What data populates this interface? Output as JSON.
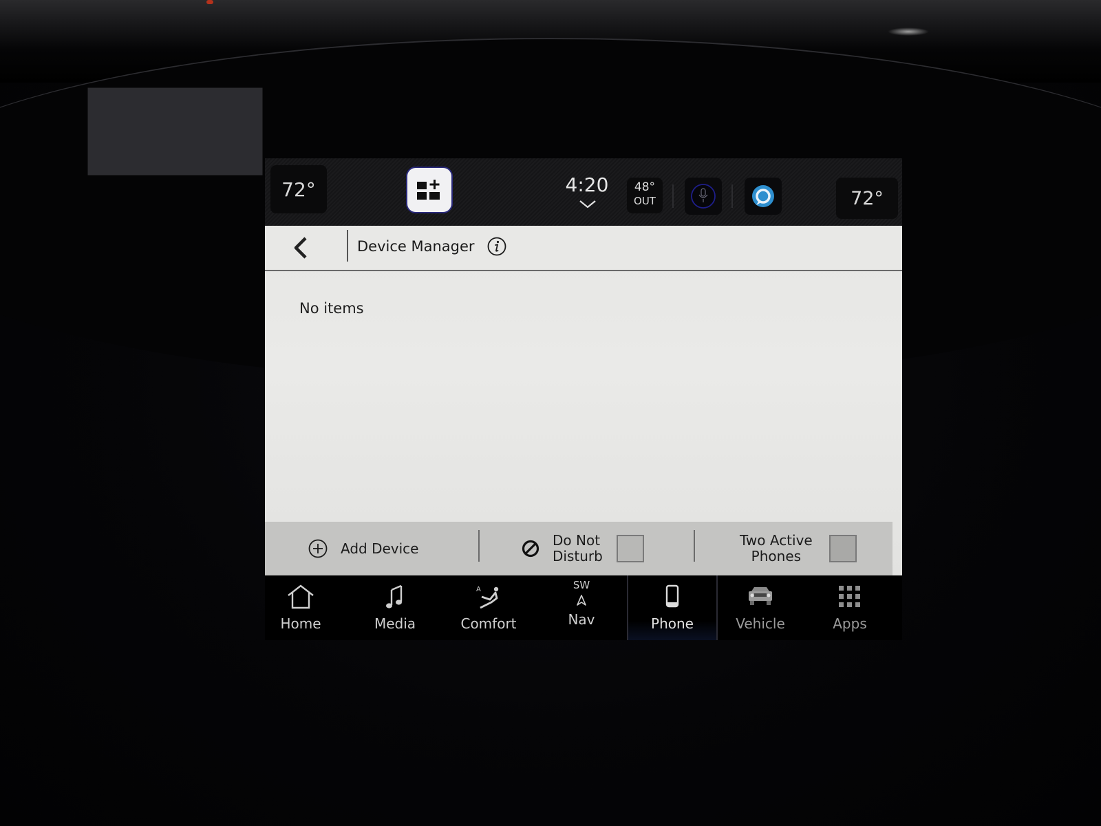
{
  "statusbar": {
    "driver_temp": "72°",
    "passenger_temp": "72°",
    "clock": "4:20",
    "outside_temp": "48°",
    "outside_label": "OUT",
    "widget_button_icon": "widgets-add-icon",
    "voice_icon": "voice-assistant-icon",
    "alexa_icon": "alexa-icon"
  },
  "header": {
    "back_icon": "chevron-left-icon",
    "title": "Device Manager",
    "info_icon": "info-icon"
  },
  "content": {
    "empty_message": "No items"
  },
  "actions": {
    "add_device": {
      "label": "Add Device",
      "icon": "plus-circle-icon"
    },
    "do_not_disturb": {
      "label_line1": "Do Not",
      "label_line2": "Disturb",
      "icon": "prohibited-icon",
      "checked": false
    },
    "two_active_phones": {
      "label_line1": "Two Active",
      "label_line2": "Phones",
      "checked": false
    }
  },
  "nav": {
    "items": [
      {
        "label": "Home",
        "icon": "home-icon"
      },
      {
        "label": "Media",
        "icon": "music-note-icon"
      },
      {
        "label": "Comfort",
        "icon": "seat-icon"
      },
      {
        "label": "Nav",
        "icon": "navigation-arrow-icon",
        "heading": "SW"
      },
      {
        "label": "Phone",
        "icon": "phone-icon",
        "active": true
      },
      {
        "label": "Vehicle",
        "icon": "truck-icon"
      },
      {
        "label": "Apps",
        "icon": "apps-grid-icon"
      }
    ]
  },
  "colors": {
    "alexa_blue": "#2e8fcf",
    "content_bg": "#e8e8e6",
    "action_bar_bg": "#c4c4c2",
    "nav_active_underline": "#0a1022"
  }
}
